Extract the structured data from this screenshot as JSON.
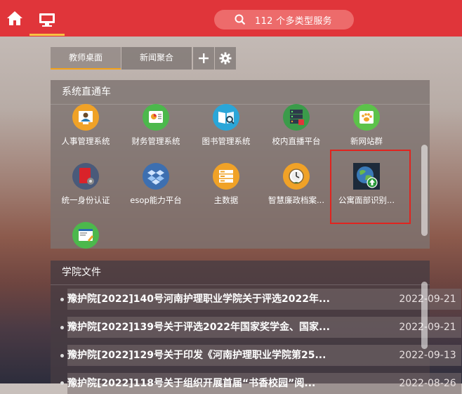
{
  "topbar": {
    "search_text": "112 个多类型服务",
    "home_icon": "home-icon",
    "desktop_icon": "monitor-icon",
    "color": "#e0353a"
  },
  "tabs": [
    {
      "label": "教师桌面",
      "active": true
    },
    {
      "label": "新闻聚合",
      "active": false
    }
  ],
  "tab_actions": {
    "add": "+",
    "settings_icon": "gear-icon"
  },
  "system_panel": {
    "title": "系统直通车",
    "apps": [
      {
        "label": "人事管理系统",
        "icon": "personnel-icon",
        "color": "#f0a227"
      },
      {
        "label": "财务管理系统",
        "icon": "finance-chart-icon",
        "color": "#4cb84c"
      },
      {
        "label": "图书管理系统",
        "icon": "book-search-icon",
        "color": "#2aa6d8"
      },
      {
        "label": "校内直播平台",
        "icon": "live-server-icon",
        "color": "#3b9b4a"
      },
      {
        "label": "新网站群",
        "icon": "paw-icon",
        "color": "#5cc24a"
      },
      {
        "label": "统一身份认证",
        "icon": "identity-icon",
        "color": "#4a5a7a"
      },
      {
        "label": "esop能力平台",
        "icon": "dropbox-icon",
        "color": "#3d6fb0"
      },
      {
        "label": "主数据",
        "icon": "database-icon",
        "color": "#f0a227"
      },
      {
        "label": "智慧廉政档案...",
        "icon": "clock-archive-icon",
        "color": "#f0a227"
      },
      {
        "label": "公寓面部识别...",
        "icon": "globe-upload-icon",
        "color": "#2e7d4a"
      },
      {
        "label": "",
        "icon": "form-edit-icon",
        "color": "#4cb84c"
      }
    ]
  },
  "docs_panel": {
    "title": "学院文件",
    "items": [
      {
        "title": "豫护院[2022]140号河南护理职业学院关于评选2022年...",
        "date": "2022-09-21"
      },
      {
        "title": "豫护院[2022]139号关于评选2022年国家奖学金、国家...",
        "date": "2022-09-21"
      },
      {
        "title": "豫护院[2022]129号关于印发《河南护理职业学院第25...",
        "date": "2022-09-13"
      },
      {
        "title": "豫护院[2022]118号关于组织开展首届“书香校园”阅...",
        "date": "2022-08-26"
      }
    ]
  }
}
